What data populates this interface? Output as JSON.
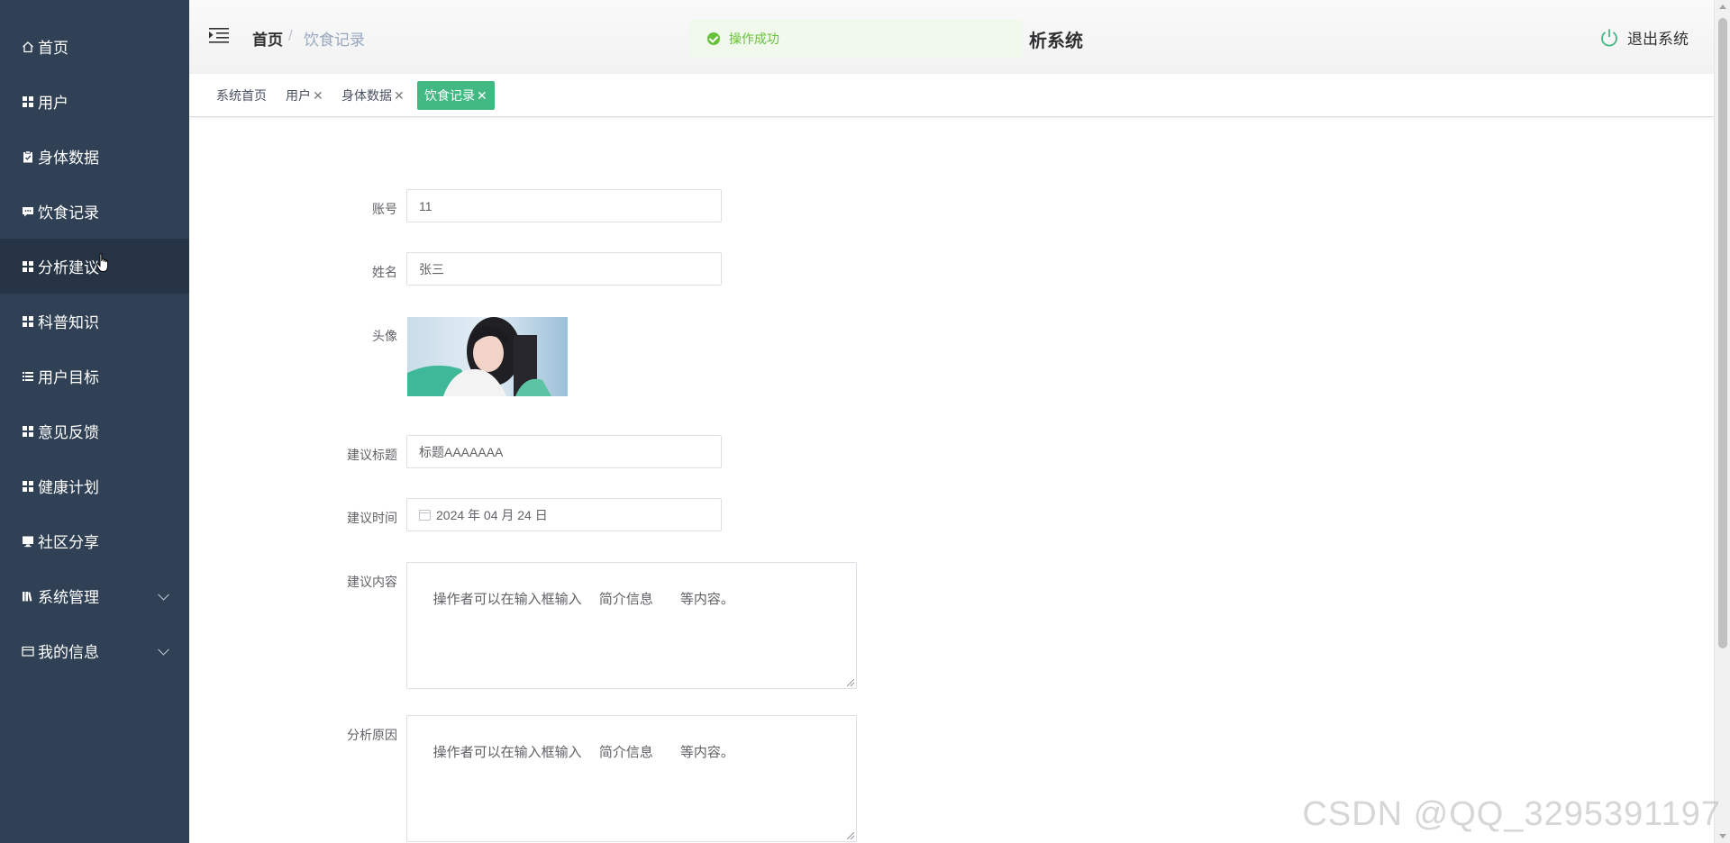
{
  "sidebar": {
    "items": [
      {
        "label": "首页",
        "icon": "home-icon"
      },
      {
        "label": "用户",
        "icon": "grid-icon"
      },
      {
        "label": "身体数据",
        "icon": "clipboard-icon"
      },
      {
        "label": "饮食记录",
        "icon": "chat-icon"
      },
      {
        "label": "分析建议",
        "icon": "grid-icon",
        "hovered": true
      },
      {
        "label": "科普知识",
        "icon": "grid-icon"
      },
      {
        "label": "用户目标",
        "icon": "list-icon"
      },
      {
        "label": "意见反馈",
        "icon": "grid-icon"
      },
      {
        "label": "健康计划",
        "icon": "grid-icon"
      },
      {
        "label": "社区分享",
        "icon": "monitor-icon"
      },
      {
        "label": "系统管理",
        "icon": "library-icon",
        "expandable": true
      },
      {
        "label": "我的信息",
        "icon": "card-icon",
        "expandable": true
      }
    ]
  },
  "header": {
    "breadcrumb": {
      "home": "首页",
      "separator": "/",
      "current": "饮食记录"
    },
    "title": "析系统",
    "logout_label": "退出系统"
  },
  "toast": {
    "message": "操作成功",
    "type": "success"
  },
  "tabs": [
    {
      "label": "系统首页",
      "closable": false,
      "active": false
    },
    {
      "label": "用户",
      "closable": true,
      "active": false
    },
    {
      "label": "身体数据",
      "closable": true,
      "active": false
    },
    {
      "label": "饮食记录",
      "closable": true,
      "active": true
    }
  ],
  "tab_close_glyph": "✕",
  "form": {
    "account": {
      "label": "账号",
      "value": "11"
    },
    "name": {
      "label": "姓名",
      "value": "张三"
    },
    "avatar": {
      "label": "头像"
    },
    "advice_title": {
      "label": "建议标题",
      "value": "标题AAAAAAA"
    },
    "advice_time": {
      "label": "建议时间",
      "value": "2024 年 04 月 24 日"
    },
    "advice_content": {
      "label": "建议内容",
      "value": "操作者可以在输入框输入　 简介信息　　等内容。"
    },
    "analysis_reason": {
      "label": "分析原因",
      "value": "操作者可以在输入框输入　 简介信息　　等内容。"
    }
  },
  "watermark": "CSDN @QQ_3295391197",
  "colors": {
    "sidebar_bg": "#304156",
    "sidebar_hover": "#263445",
    "tab_active": "#42b983",
    "toast_bg": "#f0f9eb",
    "toast_text": "#67c23a",
    "logout_icon": "#42b983"
  }
}
